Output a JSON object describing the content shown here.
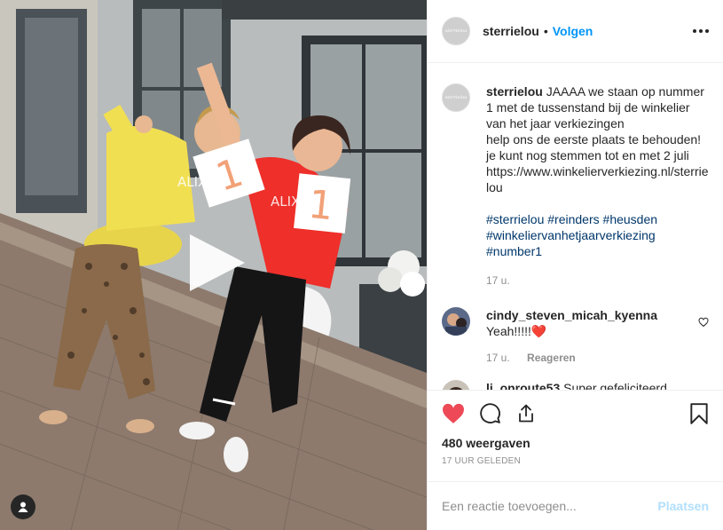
{
  "post": {
    "username": "sterrielou",
    "dot": "•",
    "follow_label": "Volgen",
    "avatar_brand": "sterrielou"
  },
  "caption": {
    "username": "sterrielou",
    "lines": [
      "JAAAA we staan op nummer 1 met de tussenstand bij de winkelier van het jaar verkiezingen",
      "help ons de eerste plaats te behouden!",
      "je kunt nog stemmen tot en met 2 juli",
      "https://www.winkelierverkiezing.nl/sterrielou"
    ],
    "hashtags": [
      "#sterrielou",
      "#reinders",
      "#heusden",
      "#winkeliervanhetjaarverkiezing",
      "#number1"
    ],
    "age": "17 u."
  },
  "comments": [
    {
      "username": "cindy_steven_micah_kyenna",
      "text": "Yeah!!!!!",
      "emoji": "❤️",
      "age": "17 u.",
      "reply_label": "Reageren"
    },
    {
      "username": "li_onroute53",
      "text": "Super gefeliciteerd"
    }
  ],
  "stats": {
    "views": "480 weergaven",
    "timestamp": "17 UUR GELEDEN",
    "liked": true
  },
  "add_comment": {
    "placeholder": "Een reactie toevoegen...",
    "post_label": "Plaatsen"
  },
  "media": {
    "sign_left": "1",
    "sign_right": "1",
    "shirt_text": "ALIX"
  },
  "colors": {
    "accent": "#0095f6",
    "like_red": "#ed4956",
    "link": "#00376b",
    "muted": "#8e8e8e"
  }
}
